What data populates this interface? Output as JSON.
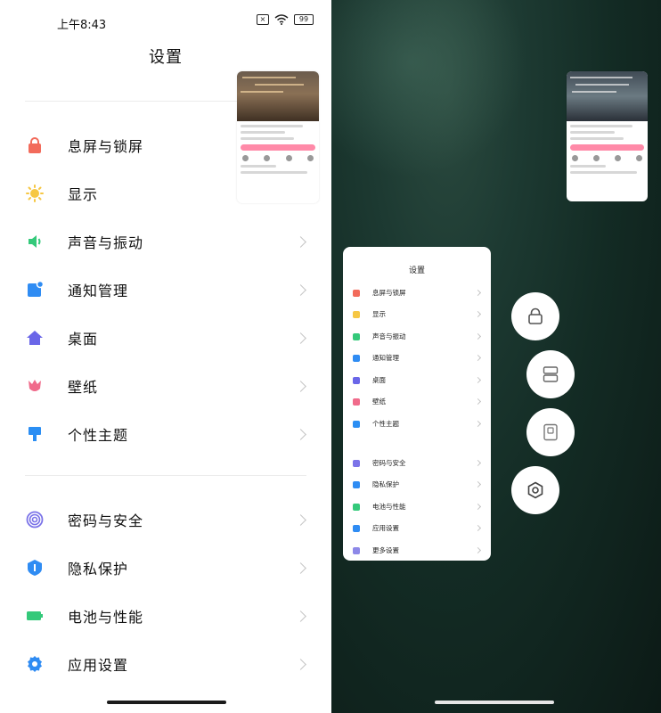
{
  "status_bar": {
    "time": "上午8:43",
    "battery": "99",
    "x_symbol": "×"
  },
  "page": {
    "title": "设置"
  },
  "menu": {
    "group1": [
      {
        "label": "息屏与锁屏",
        "icon": "lock-icon",
        "color": "#f26b5b"
      },
      {
        "label": "显示",
        "icon": "sun-icon",
        "color": "#f6c744"
      },
      {
        "label": "声音与振动",
        "icon": "speaker-icon",
        "color": "#34c97a"
      },
      {
        "label": "通知管理",
        "icon": "notification-icon",
        "color": "#2f8cf3"
      },
      {
        "label": "桌面",
        "icon": "home-icon",
        "color": "#6a66e8"
      },
      {
        "label": "壁纸",
        "icon": "tulip-icon",
        "color": "#f06b8b"
      },
      {
        "label": "个性主题",
        "icon": "brush-icon",
        "color": "#2b8ef3"
      }
    ],
    "group2": [
      {
        "label": "密码与安全",
        "icon": "fingerprint-icon",
        "color": "#7b73e8"
      },
      {
        "label": "隐私保护",
        "icon": "privacy-icon",
        "color": "#2f8cf3"
      },
      {
        "label": "电池与性能",
        "icon": "battery-icon",
        "color": "#34c97a"
      },
      {
        "label": "应用设置",
        "icon": "gear-icon",
        "color": "#2f8cf3"
      }
    ]
  },
  "floating_window": {
    "title": "设置",
    "items": [
      {
        "label": "息屏与锁屏",
        "color": "#f26b5b"
      },
      {
        "label": "显示",
        "color": "#f6c744"
      },
      {
        "label": "声音与振动",
        "color": "#34c97a"
      },
      {
        "label": "通知管理",
        "color": "#2f8cf3"
      },
      {
        "label": "桌面",
        "color": "#6a66e8"
      },
      {
        "label": "壁纸",
        "color": "#f06b8b"
      },
      {
        "label": "个性主题",
        "color": "#2b8ef3"
      },
      {
        "label": "密码与安全",
        "color": "#7b73e8"
      },
      {
        "label": "隐私保护",
        "color": "#2f8cf3"
      },
      {
        "label": "电池与性能",
        "color": "#34c97a"
      },
      {
        "label": "应用设置",
        "color": "#2f8cf3"
      },
      {
        "label": "更多设置",
        "color": "#8d88e8"
      }
    ]
  },
  "side_buttons": [
    {
      "name": "lock-button",
      "icon": "lock-icon"
    },
    {
      "name": "split-screen-button",
      "icon": "split-screen-icon"
    },
    {
      "name": "small-window-button",
      "icon": "small-window-icon"
    },
    {
      "name": "settings-hex-button",
      "icon": "hexagon-settings-icon"
    }
  ]
}
